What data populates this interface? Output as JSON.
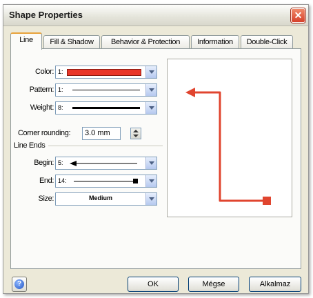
{
  "window": {
    "title": "Shape Properties"
  },
  "tabs": [
    {
      "label": "Line"
    },
    {
      "label": "Fill & Shadow"
    },
    {
      "label": "Behavior & Protection"
    },
    {
      "label": "Information"
    },
    {
      "label": "Double-Click"
    }
  ],
  "line": {
    "color_label": "Color:",
    "color_value": {
      "index": "1:",
      "swatch": "#e8372a"
    },
    "pattern_label": "Pattern:",
    "pattern_value": {
      "index": "1:"
    },
    "weight_label": "Weight:",
    "weight_value": {
      "index": "8:"
    },
    "corner_label": "Corner rounding:",
    "corner_value": "3.0 mm",
    "line_ends_heading": "Line Ends",
    "begin_label": "Begin:",
    "begin_value": {
      "index": "5:"
    },
    "end_label": "End:",
    "end_value": {
      "index": "14:"
    },
    "size_label": "Size:",
    "size_value": "Medium"
  },
  "preview": {
    "line_color": "#e0452f"
  },
  "buttons": {
    "ok": "OK",
    "cancel": "Mégse",
    "apply": "Alkalmaz",
    "help_icon": "question-icon"
  }
}
